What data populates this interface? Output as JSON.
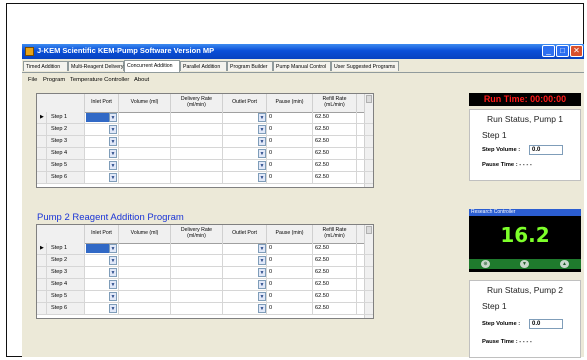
{
  "window": {
    "title": "J-KEM Scientific KEM-Pump Software   Version MP",
    "minimize_glyph": "_",
    "maximize_glyph": "□",
    "close_glyph": "✕"
  },
  "tabs": [
    {
      "label": "Timed Addition"
    },
    {
      "label": "Multi-Reagent Delivery"
    },
    {
      "label": "Concurrent Addition",
      "active": true
    },
    {
      "label": "Parallel Addition"
    },
    {
      "label": "Program Builder"
    },
    {
      "label": "Pump Manual Control"
    },
    {
      "label": "User Suggested Programs"
    }
  ],
  "menu": [
    {
      "label": "File"
    },
    {
      "label": "Program"
    },
    {
      "label": "Temperature Controller"
    },
    {
      "label": "About"
    }
  ],
  "grid_columns": {
    "inlet": "Inlet Port",
    "volume": "Volume (ml)",
    "delivery": "Delivery Rate (ml/min)",
    "outlet": "Outlet Port",
    "pause": "Pause (min)",
    "refill": "Refill Rate (mL/min)"
  },
  "pump1": {
    "rows": [
      {
        "step": "Step 1",
        "pause": "0",
        "refill": "62.50"
      },
      {
        "step": "Step 2",
        "pause": "0",
        "refill": "62.50"
      },
      {
        "step": "Step 3",
        "pause": "0",
        "refill": "62.50"
      },
      {
        "step": "Step 4",
        "pause": "0",
        "refill": "62.50"
      },
      {
        "step": "Step 5",
        "pause": "0",
        "refill": "62.50"
      },
      {
        "step": "Step 6",
        "pause": "0",
        "refill": "62.50"
      }
    ]
  },
  "pump2": {
    "section_title": "Pump 2 Reagent Addition Program",
    "rows": [
      {
        "step": "Step 1",
        "pause": "0",
        "refill": "62.50"
      },
      {
        "step": "Step 2",
        "pause": "0",
        "refill": "62.50"
      },
      {
        "step": "Step 3",
        "pause": "0",
        "refill": "62.50"
      },
      {
        "step": "Step 4",
        "pause": "0",
        "refill": "62.50"
      },
      {
        "step": "Step 5",
        "pause": "0",
        "refill": "62.50"
      },
      {
        "step": "Step 6",
        "pause": "0",
        "refill": "62.50"
      }
    ]
  },
  "run_time": "Run Time: 00:00:00",
  "status1": {
    "heading": "Run Status, Pump 1",
    "step": "Step 1",
    "step_volume_label": "Step Volume :",
    "step_volume_value": "0.0",
    "pause_time_label": "Pause Time : - - - -"
  },
  "status2": {
    "heading": "Run Status, Pump 2",
    "step": "Step 1",
    "step_volume_label": "Step Volume :",
    "step_volume_value": "0.0",
    "pause_time_label": "Pause Time : - - - -"
  },
  "controller": {
    "title": "Research Controller",
    "value": "16.2",
    "buttons": [
      "⊕",
      "▼",
      "▲"
    ]
  },
  "colors": {
    "titlebar": "#0a4fd8",
    "section_title": "#1b35d6",
    "run_time_text": "#ff1a1a",
    "controller_value": "#7dff2a",
    "controller_buttons_bg": "#1f7a2d",
    "selected_cell": "#3169c6"
  }
}
